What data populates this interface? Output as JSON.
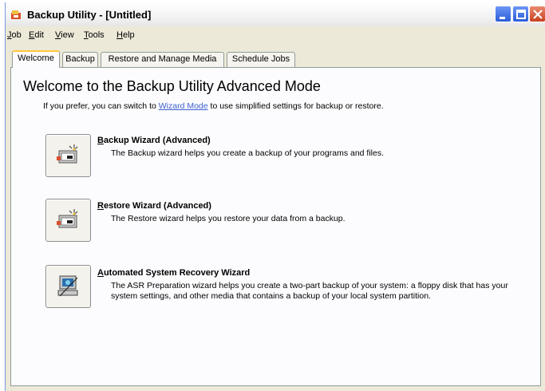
{
  "window": {
    "title": "Backup Utility - [Untitled]"
  },
  "menu": [
    {
      "accel": "J",
      "rest": "ob"
    },
    {
      "accel": "E",
      "rest": "dit"
    },
    {
      "accel": "V",
      "rest": "iew"
    },
    {
      "accel": "T",
      "rest": "ools"
    },
    {
      "accel": "H",
      "rest": "elp"
    }
  ],
  "tabs": [
    "Welcome",
    "Backup",
    "Restore and Manage Media",
    "Schedule Jobs"
  ],
  "welcome": {
    "heading": "Welcome to the Backup Utility Advanced Mode",
    "intro_before": "If you prefer, you can switch to ",
    "intro_link": "Wizard Mode",
    "intro_after": " to use simplified settings for backup or restore."
  },
  "wizards": [
    {
      "title_accel": "B",
      "title_rest": "ackup Wizard (Advanced)",
      "description": "The Backup wizard helps you create a backup of your programs and files.",
      "icon": "backup-wizard-icon"
    },
    {
      "title_accel": "R",
      "title_rest": "estore Wizard (Advanced)",
      "description": "The Restore wizard helps you restore your data from a backup.",
      "icon": "restore-wizard-icon"
    },
    {
      "title_accel": "A",
      "title_rest": "utomated System Recovery Wizard",
      "description": "The ASR Preparation wizard helps you create a two-part backup of your system: a floppy disk that has your system settings, and other media that contains a backup of your local system partition.",
      "icon": "asr-wizard-icon"
    }
  ],
  "colors": {
    "titlebar_close": "#c8401f",
    "titlebar_buttons": "#2a5fd8",
    "link": "#3b5fd0",
    "active_tab_accent": "#ffc83c"
  }
}
